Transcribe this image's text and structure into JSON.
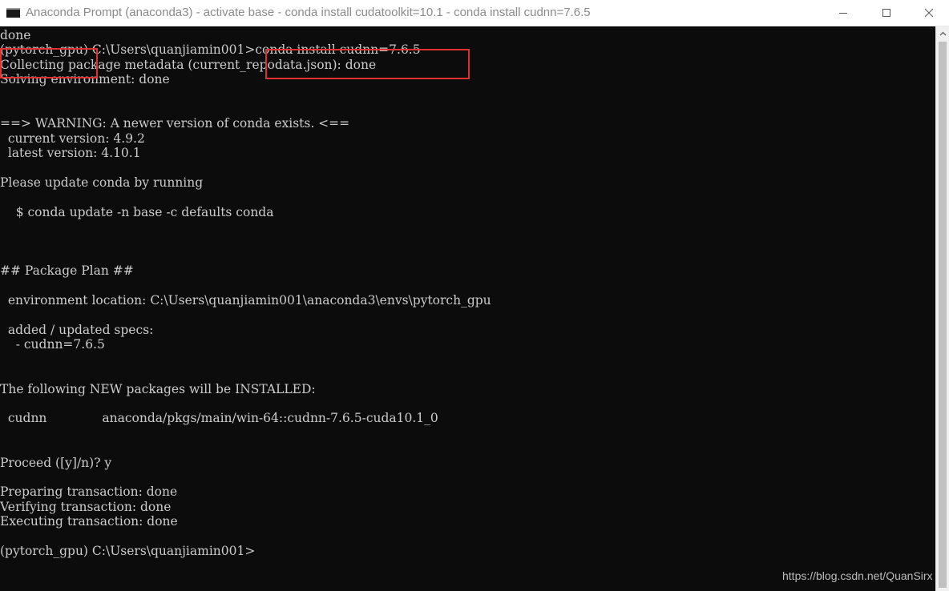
{
  "window": {
    "title": "Anaconda Prompt (anaconda3) - activate  base - conda  install cudatoolkit=10.1 - conda  install cudnn=7.6.5",
    "icon": "console-icon",
    "controls": {
      "minimize": "minimize-icon",
      "maximize": "maximize-icon",
      "close": "close-icon"
    }
  },
  "console": {
    "lines": [
      "done",
      "(pytorch_gpu) C:\\Users\\quanjiamin001>conda install cudnn=7.6.5",
      "Collecting package metadata (current_repodata.json): done",
      "Solving environment: done",
      "",
      "",
      "==> WARNING: A newer version of conda exists. <==",
      "  current version: 4.9.2",
      "  latest version: 4.10.1",
      "",
      "Please update conda by running",
      "",
      "    $ conda update -n base -c defaults conda",
      "",
      "",
      "",
      "## Package Plan ##",
      "",
      "  environment location: C:\\Users\\quanjiamin001\\anaconda3\\envs\\pytorch_gpu",
      "",
      "  added / updated specs:",
      "    - cudnn=7.6.5",
      "",
      "",
      "The following NEW packages will be INSTALLED:",
      "",
      "  cudnn              anaconda/pkgs/main/win-64::cudnn-7.6.5-cuda10.1_0",
      "",
      "",
      "Proceed ([y]/n)? y",
      "",
      "Preparing transaction: done",
      "Verifying transaction: done",
      "Executing transaction: done",
      "",
      "(pytorch_gpu) C:\\Users\\quanjiamin001>"
    ]
  },
  "highlights": [
    {
      "label": "env-name-highlight"
    },
    {
      "label": "command-highlight"
    }
  ],
  "colors": {
    "console_bg": "#0c0c0c",
    "console_text": "#cccccc",
    "highlight": "#e03131",
    "titlebar_bg": "#ffffff"
  },
  "watermark": "https://blog.csdn.net/QuanSirx"
}
